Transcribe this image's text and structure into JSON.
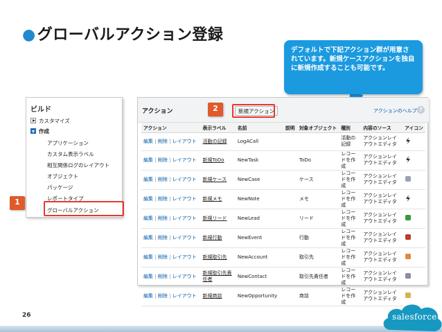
{
  "slide": {
    "bullet": "●",
    "title": "グローバルアクション登録",
    "page_number": "26"
  },
  "callout": {
    "text": "デフォルトで下記アクション群が用意されています。新規ケースアクションを独自に新規作成することも可能です。"
  },
  "badges": {
    "one": "1",
    "two": "2"
  },
  "sidebar": {
    "title": "ビルド",
    "customize": "カスタマイズ",
    "create": "作成",
    "items": [
      "アプリケーション",
      "カスタム表示ラベル",
      "相互関係ログのレイアウト",
      "オブジェクト",
      "パッケージ",
      "レポートタイプ",
      "グローバルアクション"
    ]
  },
  "action_panel": {
    "title": "アクション",
    "new_button": "新規アクション",
    "help_link": "アクションのヘルプ",
    "help_icon": "?",
    "columns": [
      "アクション",
      "表示ラベル",
      "名前",
      "説明",
      "対象オブジェクト",
      "種別",
      "内容のソース",
      "アイコン"
    ],
    "ops": {
      "edit": "編集",
      "delete": "削除",
      "layout": "レイアウト",
      "sep": "|"
    },
    "rows": [
      {
        "label": "活動の記録",
        "name": "LogACall",
        "object": "",
        "kind": "活動の記録",
        "source": "アクションレイアウトエディタ",
        "icon": "bolt-icon",
        "icon_color": "#333333"
      },
      {
        "label": "新規ToDo",
        "name": "NewTask",
        "object": "ToDo",
        "kind": "レコードを作成",
        "source": "アクションレイアウトエディタ",
        "icon": "bolt-icon",
        "icon_color": "#333333"
      },
      {
        "label": "新規ケース",
        "name": "NewCase",
        "object": "ケース",
        "kind": "レコードを作成",
        "source": "アクションレイアウトエディタ",
        "icon": "case-icon",
        "icon_color": "#9aa3ad"
      },
      {
        "label": "新規メモ",
        "name": "NewNote",
        "object": "メモ",
        "kind": "レコードを作成",
        "source": "アクションレイアウトエディタ",
        "icon": "bolt-icon",
        "icon_color": "#333333"
      },
      {
        "label": "新規リード",
        "name": "NewLead",
        "object": "リード",
        "kind": "レコードを作成",
        "source": "アクションレイアウトエディタ",
        "icon": "lead-icon",
        "icon_color": "#3a9a3a"
      },
      {
        "label": "新規行動",
        "name": "NewEvent",
        "object": "行動",
        "kind": "レコードを作成",
        "source": "アクションレイアウトエディタ",
        "icon": "calendar-icon",
        "icon_color": "#c0392b"
      },
      {
        "label": "新規取引先",
        "name": "NewAccount",
        "object": "取引先",
        "kind": "レコードを作成",
        "source": "アクションレイアウトエディタ",
        "icon": "account-icon",
        "icon_color": "#e08a3a"
      },
      {
        "label": "新規取引先責任者",
        "name": "NewContact",
        "object": "取引先責任者",
        "kind": "レコードを作成",
        "source": "アクションレイアウトエディタ",
        "icon": "contact-icon",
        "icon_color": "#8a8fa0"
      },
      {
        "label": "新規商談",
        "name": "NewOpportunity",
        "object": "商談",
        "kind": "レコードを作成",
        "source": "アクションレイアウトエディタ",
        "icon": "opportunity-icon",
        "icon_color": "#d9b24a"
      }
    ]
  },
  "logo": {
    "text": "salesforce",
    "color": "#1798c1"
  }
}
